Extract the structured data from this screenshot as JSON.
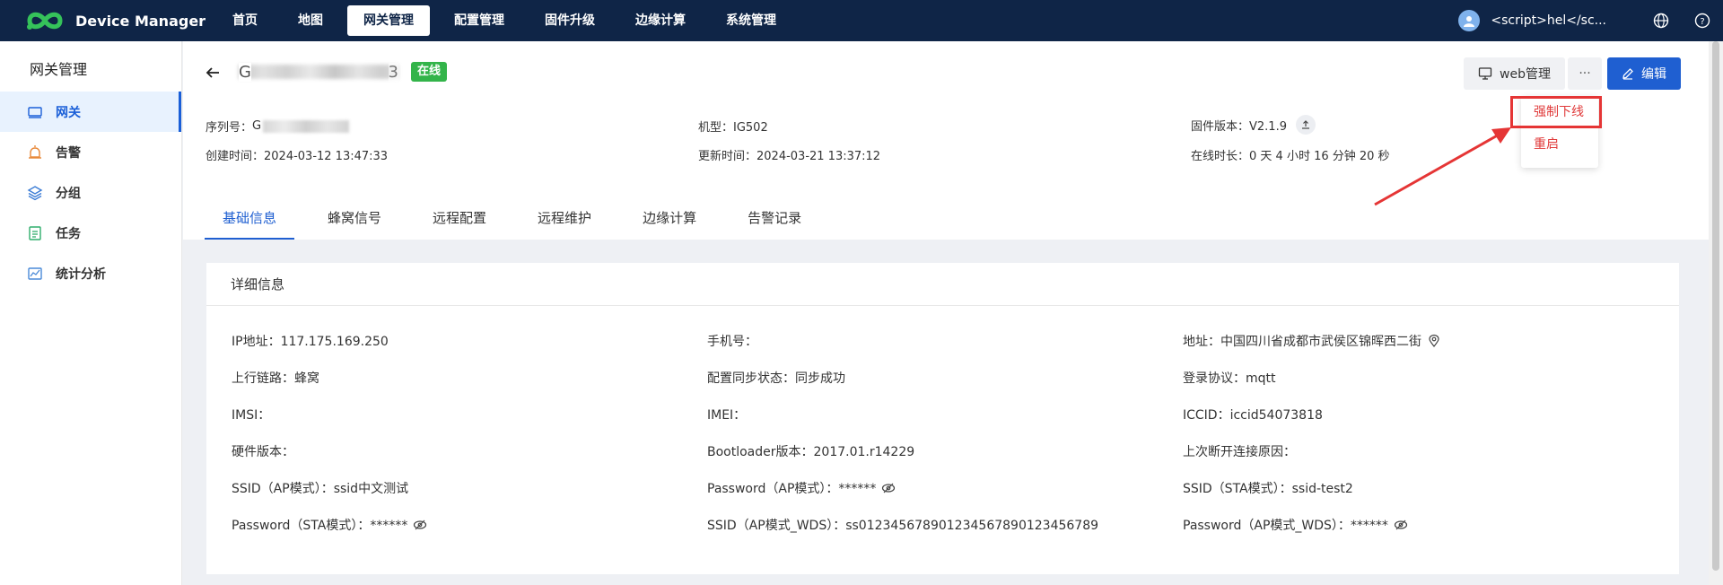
{
  "app": {
    "title": "Device Manager",
    "nav": [
      "首页",
      "地图",
      "网关管理",
      "配置管理",
      "固件升级",
      "边缘计算",
      "系统管理"
    ],
    "active_nav": "网关管理",
    "user_name": "<script>hel</sc..."
  },
  "sidebar": {
    "title": "网关管理",
    "items": [
      {
        "label": "网关",
        "icon": "gateway-icon"
      },
      {
        "label": "告警",
        "icon": "alarm-icon"
      },
      {
        "label": "分组",
        "icon": "layers-icon"
      },
      {
        "label": "任务",
        "icon": "task-icon"
      },
      {
        "label": "统计分析",
        "icon": "chart-icon"
      }
    ]
  },
  "device": {
    "name_lead": "G",
    "name_tail": "3",
    "status": "在线",
    "buttons": {
      "web": "web管理",
      "more": "···",
      "edit": "编辑"
    },
    "info": {
      "serial_label": "序列号：",
      "serial_lead": "G",
      "created": "创建时间：2024-03-12 13:47:33",
      "model": "机型：IG502",
      "updated": "更新时间：2024-03-21 13:37:12",
      "firmware": "固件版本：V2.1.9",
      "uptime": "在线时长：0 天 4 小时 16 分钟 20 秒"
    },
    "dropdown": [
      "强制下线",
      "重启"
    ]
  },
  "tabs": [
    "基础信息",
    "蜂窝信号",
    "远程配置",
    "远程维护",
    "边缘计算",
    "告警记录"
  ],
  "detail": {
    "title": "详细信息",
    "col1": [
      "IP地址：117.175.169.250",
      "上行链路：蜂窝",
      "IMSI：",
      "硬件版本：",
      "SSID（AP模式）：ssid中文测试",
      "Password（STA模式）：******"
    ],
    "col2": [
      "手机号：",
      "配置同步状态：同步成功",
      "IMEI：",
      "Bootloader版本：2017.01.r14229",
      "Password（AP模式）：******",
      "SSID（AP模式_WDS）：ss012345678901234567890123456789"
    ],
    "col3": [
      "地址：中国四川省成都市武侯区锦晖西二街",
      "登录协议：mqtt",
      "ICCID：iccid54073818",
      "上次断开连接原因：",
      "SSID（STA模式）：ssid-test2",
      "Password（AP模式_WDS）：******"
    ]
  },
  "colors": {
    "nav_bg": "#0f2547",
    "accent": "#1f5fd1",
    "online": "#33b44a",
    "danger": "#e53535"
  }
}
